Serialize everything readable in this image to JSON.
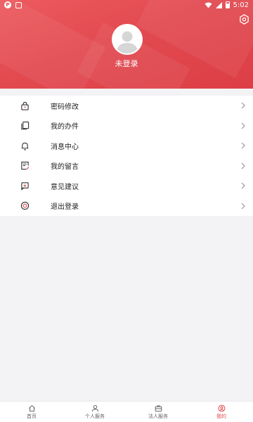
{
  "status_bar": {
    "time": "5:02"
  },
  "header": {
    "login_label": "未登录"
  },
  "menu": {
    "items": [
      {
        "label": "密码修改",
        "icon": "lock-icon"
      },
      {
        "label": "我的办件",
        "icon": "documents-icon"
      },
      {
        "label": "消息中心",
        "icon": "bell-icon"
      },
      {
        "label": "我的留言",
        "icon": "note-icon"
      },
      {
        "label": "意见建议",
        "icon": "feedback-icon"
      },
      {
        "label": "退出登录",
        "icon": "logout-icon"
      }
    ]
  },
  "tabbar": {
    "tabs": [
      {
        "label": "首页",
        "icon": "home-icon"
      },
      {
        "label": "个人服务",
        "icon": "person-icon"
      },
      {
        "label": "法人服务",
        "icon": "briefcase-icon"
      },
      {
        "label": "我的",
        "icon": "profile-icon",
        "active": true
      }
    ]
  },
  "colors": {
    "accent": "#e24a50",
    "background": "#f3f3f6"
  }
}
